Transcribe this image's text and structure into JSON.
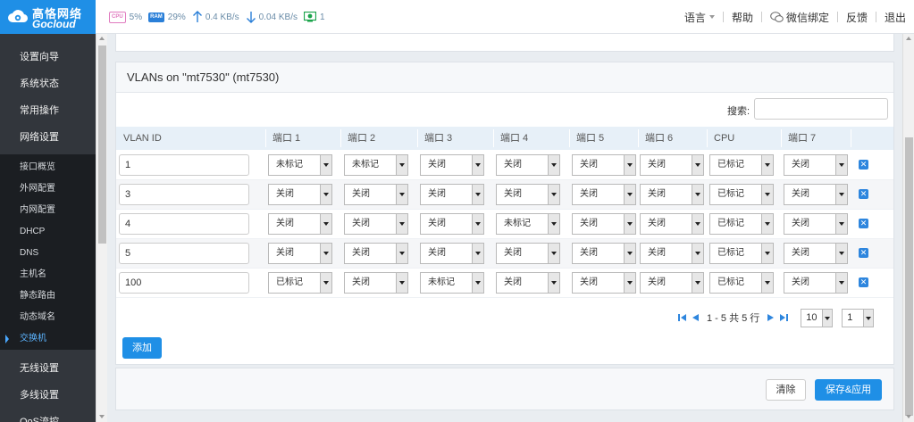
{
  "header": {
    "logo_cn": "高恪网络",
    "logo_en": "Gocloud",
    "stats": {
      "cpu_label": "CPU",
      "cpu": "5%",
      "ram_label": "RAM",
      "ram": "29%",
      "upload": "0.4 KB/s",
      "download": "0.04 KB/s",
      "devices": "1"
    },
    "menu": {
      "language": "语言",
      "help": "帮助",
      "wechat": "微信绑定",
      "feedback": "反馈",
      "logout": "退出"
    }
  },
  "sidebar": {
    "items": [
      {
        "label": "设置向导"
      },
      {
        "label": "系统状态"
      },
      {
        "label": "常用操作"
      },
      {
        "label": "网络设置"
      }
    ],
    "subitems": [
      {
        "label": "接口概览"
      },
      {
        "label": "外网配置"
      },
      {
        "label": "内网配置"
      },
      {
        "label": "DHCP"
      },
      {
        "label": "DNS"
      },
      {
        "label": "主机名"
      },
      {
        "label": "静态路由"
      },
      {
        "label": "动态域名"
      },
      {
        "label": "交换机"
      }
    ],
    "bottom_items": [
      {
        "label": "无线设置"
      },
      {
        "label": "多线设置"
      },
      {
        "label": "QoS流控"
      }
    ]
  },
  "panel": {
    "title": "VLANs on \"mt7530\" (mt7530)",
    "search_label": "搜索:",
    "search_value": "",
    "columns": [
      "VLAN ID",
      "端口 1",
      "端口 2",
      "端口 3",
      "端口 4",
      "端口 5",
      "端口 6",
      "CPU",
      "端口 7"
    ],
    "rows": [
      {
        "vlan_id": "1",
        "ports": [
          "未标记",
          "未标记",
          "关闭",
          "关闭",
          "关闭",
          "关闭",
          "已标记",
          "关闭"
        ]
      },
      {
        "vlan_id": "3",
        "ports": [
          "关闭",
          "关闭",
          "关闭",
          "关闭",
          "关闭",
          "关闭",
          "已标记",
          "关闭"
        ]
      },
      {
        "vlan_id": "4",
        "ports": [
          "关闭",
          "关闭",
          "关闭",
          "未标记",
          "关闭",
          "关闭",
          "已标记",
          "关闭"
        ]
      },
      {
        "vlan_id": "5",
        "ports": [
          "关闭",
          "关闭",
          "关闭",
          "关闭",
          "关闭",
          "关闭",
          "已标记",
          "关闭"
        ]
      },
      {
        "vlan_id": "100",
        "ports": [
          "已标记",
          "关闭",
          "未标记",
          "关闭",
          "关闭",
          "关闭",
          "已标记",
          "关闭"
        ]
      }
    ],
    "delete_symbol": "✕",
    "pager": {
      "range_text": "1 - 5 共 5 行",
      "page_size": "10",
      "page": "1"
    },
    "add_label": "添加"
  },
  "footer": {
    "clear_label": "清除",
    "save_label": "保存&应用"
  },
  "colors": {
    "accent": "#1f8fe6",
    "sidebar_bg": "#32363c",
    "sidebar_sub_bg": "#1b1e22",
    "header_row_bg": "#e7f0f8"
  }
}
